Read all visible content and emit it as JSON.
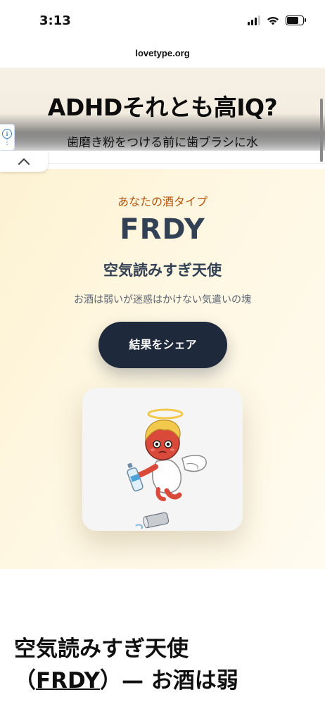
{
  "status_bar": {
    "time": "3:13"
  },
  "browser": {
    "url": "lovetype.org"
  },
  "ad": {
    "headline": "ADHDそれとも高IQ?",
    "subtext": "歯磨き粉をつける前に歯ブラシに水"
  },
  "result": {
    "label": "あなたの酒タイプ",
    "code": "FRDY",
    "name": "空気読みすぎ天使",
    "description": "お酒は弱いが迷惑はかけない気遣いの塊",
    "share_button": "結果をシェア",
    "image_icon": "angel-with-water-bottle-illustration"
  },
  "article": {
    "title_line1": "空気読みすぎ天使",
    "title_line2_open": "（",
    "title_code": "FRDY",
    "title_line2_rest": "）— お酒は弱"
  }
}
